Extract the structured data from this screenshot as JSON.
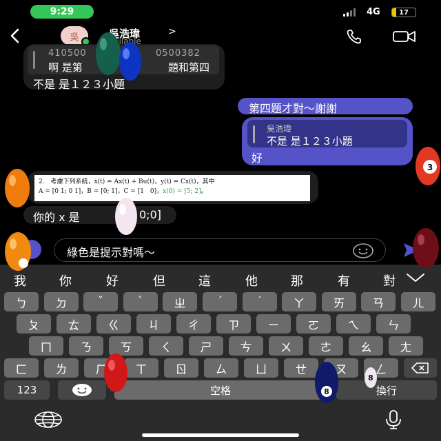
{
  "status": {
    "time": "9:29",
    "network": "4G",
    "battery_level": "17",
    "battery_fraction": 0.17
  },
  "header": {
    "back_icon": "chevron-left-icon",
    "avatar_text": "吳",
    "contact_name": "吳浩瑋",
    "chevron": ">",
    "presence": "vailable",
    "call_icon": "phone-icon",
    "video_icon": "video-camera-icon"
  },
  "messages": {
    "first": {
      "quote_id_left": "410500",
      "quote_id_right": "0500382",
      "quote_text_left": "啊 是第",
      "quote_text_right": "題和第四",
      "text": "不是 是１２３小題"
    },
    "second": {
      "text": "第四題才對～謝謝"
    },
    "third": {
      "quote_author": "吳浩瑋",
      "quote_text": "不是 是１２３小題",
      "text": "好"
    },
    "fourth": {
      "line1": "2.　考慮下列系統，ẋ(t) = Ax(t) + Bu(t)，y(t) = Cx(t)，其中",
      "line2_a": "A = [0 1; 0 1]，B = [0; 1]，C = [1　0]，",
      "line2_b": "x(0) = [5; 2]",
      "line2_c": "。",
      "text_left": "你的 x 是",
      "text_right": "0;0]"
    }
  },
  "input": {
    "value": "綠色是提示對嗎～",
    "emoji_icon": "smiley-icon",
    "send_icon": "send-arrow-icon"
  },
  "keyboard": {
    "candidates": [
      "我",
      "你",
      "好",
      "但",
      "這",
      "他",
      "那",
      "有",
      "對"
    ],
    "row1": [
      "ㄅ",
      "ㄉ",
      "ˇ",
      "ˋ",
      "ㄓ",
      "ˊ",
      "˙",
      "ㄚ",
      "ㄞ",
      "ㄢ",
      "ㄦ"
    ],
    "row2": [
      "ㄆ",
      "ㄊ",
      "ㄍ",
      "ㄐ",
      "ㄔ",
      "ㄗ",
      "ㄧ",
      "ㄛ",
      "ㄟ",
      "ㄣ"
    ],
    "row3": [
      "ㄇ",
      "ㄋ",
      "ㄎ",
      "ㄑ",
      "ㄕ",
      "ㄘ",
      "ㄨ",
      "ㄜ",
      "ㄠ",
      "ㄤ"
    ],
    "row4": [
      "ㄈ",
      "ㄌ",
      "ㄏ",
      "ㄒ",
      "ㄖ",
      "ㄙ",
      "ㄩ",
      "ㄝ",
      "ㄡ",
      "ㄥ"
    ],
    "numbers_label": "123",
    "space_label": "空格",
    "return_label": "換行",
    "delete_icon": "backspace-icon",
    "globe_icon": "globe-icon",
    "mic_icon": "microphone-icon",
    "emoji_icon": "emoji-key-icon"
  },
  "overlays": {
    "ball_numbers": [
      "3",
      "8",
      "8"
    ]
  },
  "colors": {
    "outgoing_bubble": "#5553c8",
    "incoming_bubble": "#1e1e1e",
    "status_green": "#35c659",
    "battery_yellow": "#f5c400"
  }
}
